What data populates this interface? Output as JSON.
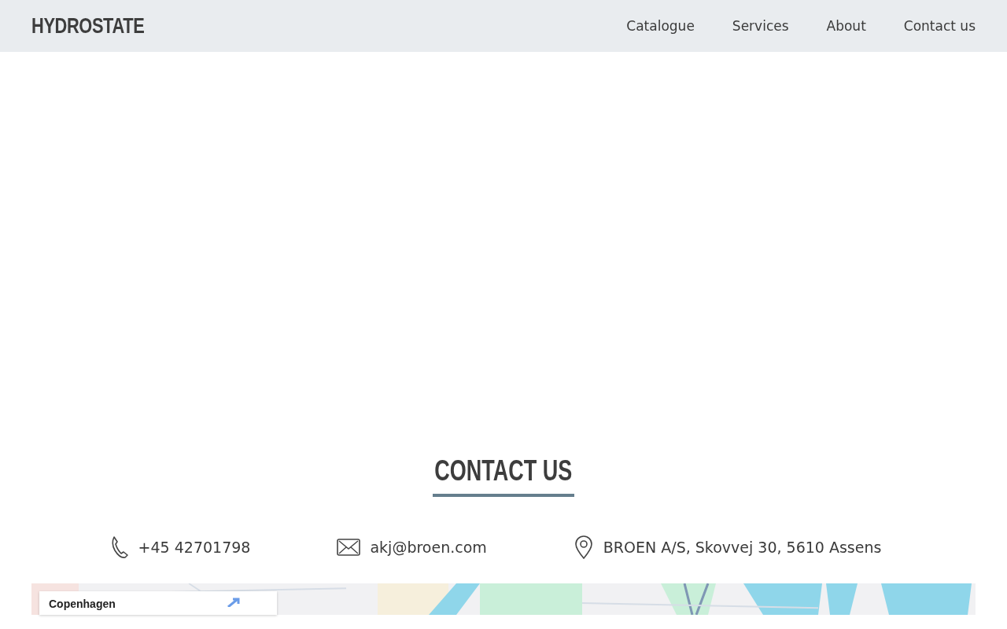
{
  "header": {
    "logo": "HYDROSTATE",
    "nav": [
      {
        "label": "Catalogue"
      },
      {
        "label": "Services"
      },
      {
        "label": "About"
      },
      {
        "label": "Contact us"
      }
    ]
  },
  "contact": {
    "heading": "CONTACT US",
    "items": [
      {
        "kind": "phone",
        "text": "+45 42701798"
      },
      {
        "kind": "email",
        "text": "akj@broen.com"
      },
      {
        "kind": "address",
        "text": "BROEN A/S, Skovvej 30, 5610 Assens"
      }
    ]
  },
  "map": {
    "kind": "picture",
    "card": {
      "title": "Copenhagen"
    }
  }
}
